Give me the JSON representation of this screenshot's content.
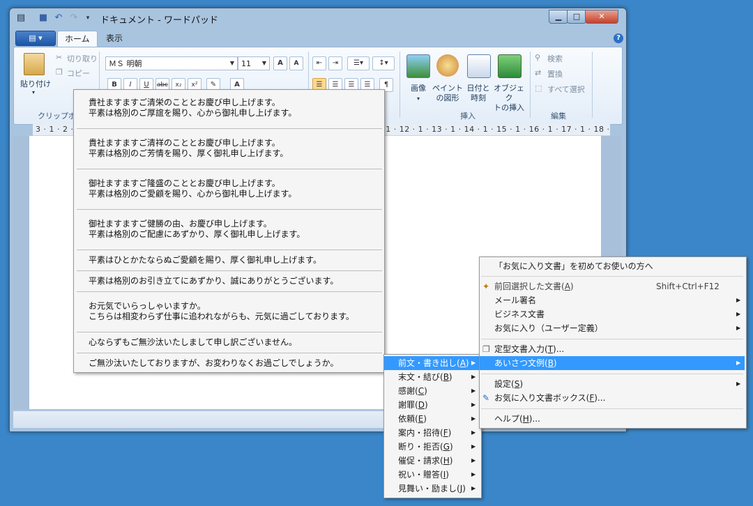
{
  "window": {
    "title": "ドキュメント - ワードパッド",
    "qat": [
      "save-icon",
      "undo-icon",
      "redo-icon"
    ]
  },
  "tabs": [
    "ホーム",
    "表示"
  ],
  "ribbon": {
    "clipboard": {
      "paste": "貼り付け",
      "cut": "切り取り",
      "copy": "コピー",
      "group": "クリップボード"
    },
    "font": {
      "name": "ＭＳ 明朝",
      "size": "11"
    },
    "insert": {
      "image_1": "画像",
      "paint_1": "ペイント",
      "paint_2": "の図形",
      "datetime_1": "日付と",
      "datetime_2": "時刻",
      "object_1": "オブジェク",
      "object_2": "トの挿入",
      "group": "挿入"
    },
    "edit": {
      "find": "検索",
      "replace": "置換",
      "select_all": "すべて選択",
      "group": "編集"
    }
  },
  "ruler": "3 · 1 · 2 · 1 · 1 · 1 · 2 · 1 · 3 · 1 · 4 · 1 · 5 · 1 · 6 · 1 · 7 · 1 · 8 · 1 · 9 · 1 · 10 · 1 · 11 · 1 · 12 · 1 · 13 · 1 · 14 · 1 · 15 · 1 · 16 · 1 · 17 · 1 · 18 ·",
  "greetings": [
    {
      "l1": "貴社ますますご清栄のこととお慶び申し上げます。",
      "l2": "平素は格別のご厚誼を賜り、心から御礼申し上げます。"
    },
    {
      "l1": "貴社ますますご清祥のこととお慶び申し上げます。",
      "l2": "平素は格別のご芳情を賜り、厚く御礼申し上げます。"
    },
    {
      "l1": "御社ますますご隆盛のこととお慶び申し上げます。",
      "l2": "平素は格別のご愛顧を賜り、心から御礼申し上げます。"
    },
    {
      "l1": "御社ますますご健勝の由、お慶び申し上げます。",
      "l2": "平素は格別のご配慮にあずかり、厚く御礼申し上げます。"
    },
    {
      "l1": "平素はひとかたならぬご愛顧を賜り、厚く御礼申し上げます。",
      "l2": ""
    },
    {
      "l1": "平素は格別のお引き立てにあずかり、誠にありがとうございます。",
      "l2": ""
    },
    {
      "l1": "お元気でいらっしゃいますか。",
      "l2": "こちらは相変わらず仕事に追われながらも、元気に過ごしております。"
    },
    {
      "l1": "心ならずもご無沙汰いたしまして申し訳ございません。",
      "l2": ""
    },
    {
      "l1": "ご無沙汰いたしておりますが、お変わりなくお過ごしでしょうか。",
      "l2": ""
    }
  ],
  "category_menu": [
    {
      "label": "前文・書き出し(",
      "key": "A",
      "tail": ")"
    },
    {
      "label": "末文・結び(",
      "key": "B",
      "tail": ")"
    },
    {
      "label": "感謝(",
      "key": "C",
      "tail": ")"
    },
    {
      "label": "謝罪(",
      "key": "D",
      "tail": ")"
    },
    {
      "label": "依頼(",
      "key": "E",
      "tail": ")"
    },
    {
      "label": "案内・招待(",
      "key": "F",
      "tail": ")"
    },
    {
      "label": "断り・拒否(",
      "key": "G",
      "tail": ")"
    },
    {
      "label": "催促・請求(",
      "key": "H",
      "tail": ")"
    },
    {
      "label": "祝い・贈答(",
      "key": "I",
      "tail": ")"
    },
    {
      "label": "見舞い・励まし(",
      "key": "J",
      "tail": ")"
    }
  ],
  "main_menu": {
    "intro": "「お気に入り文書」を初めてお使いの方へ",
    "previous": {
      "label": "前回選択した文書(",
      "key": "A",
      "tail": ")",
      "shortcut": "Shift+Ctrl+F12"
    },
    "mail_sig": "メール署名",
    "business": "ビジネス文書",
    "favorites_user": "お気に入り（ユーザー定義）",
    "template": {
      "label": "定型文書入力(",
      "key": "T",
      "tail": ")..."
    },
    "greeting_ex": {
      "label": "あいさつ文例(",
      "key": "B",
      "tail": ")"
    },
    "settings": {
      "label": "設定(",
      "key": "S",
      "tail": ")"
    },
    "favbox": {
      "label": "お気に入り文書ボックス(",
      "key": "F",
      "tail": ")..."
    },
    "help": {
      "label": "ヘルプ(",
      "key": "H",
      "tail": ")..."
    }
  }
}
